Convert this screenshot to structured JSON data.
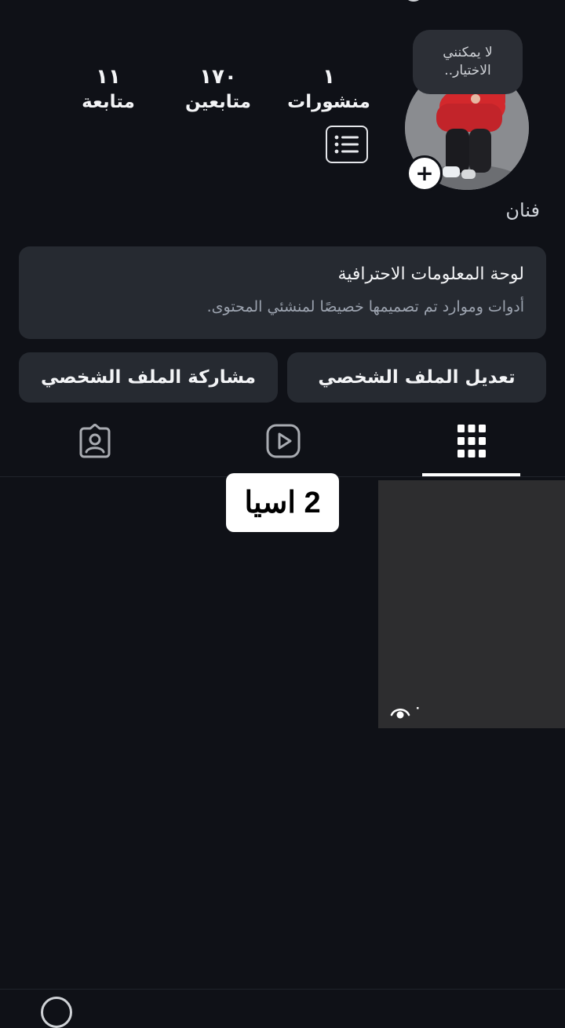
{
  "profile": {
    "tooltip": "لا يمكنني الاختيار..",
    "name": "فنان",
    "stats": [
      {
        "count": "١",
        "label": "منشورات"
      },
      {
        "count": "١٧٠",
        "label": "متابعين"
      },
      {
        "count": "١١",
        "label": "متابعة"
      }
    ]
  },
  "dashboard": {
    "title": "لوحة المعلومات الاحترافية",
    "subtitle": "أدوات وموارد تم تصميمها خصيصًا لمنشئي المحتوى."
  },
  "buttons": {
    "edit_profile": "تعديل الملف الشخصي",
    "share_profile": "مشاركة الملف الشخصي"
  },
  "tabs": [
    {
      "icon": "grid-icon",
      "selected": true
    },
    {
      "icon": "reels-icon",
      "selected": false
    },
    {
      "icon": "tagged-icon",
      "selected": false
    }
  ],
  "post": {
    "views": "٠"
  },
  "overlay": {
    "caption": "2 اسيا"
  },
  "colors": {
    "background": "#0f1117",
    "card": "#262a31",
    "text": "#f3f4f6",
    "muted": "#9ca3af"
  }
}
